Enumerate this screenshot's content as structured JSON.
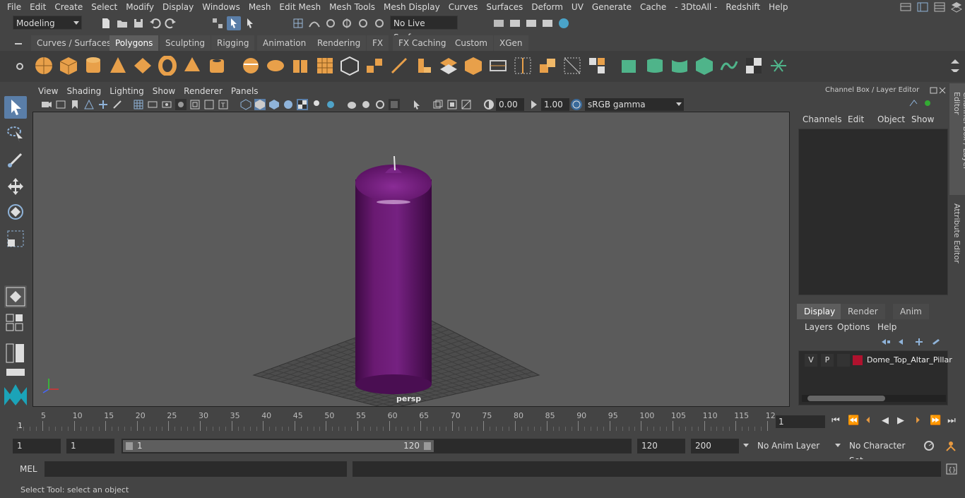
{
  "menubar": {
    "items": [
      "File",
      "Edit",
      "Create",
      "Select",
      "Modify",
      "Display",
      "Windows",
      "Mesh",
      "Edit Mesh",
      "Mesh Tools",
      "Mesh Display",
      "Curves",
      "Surfaces",
      "Deform",
      "UV",
      "Generate",
      "Cache",
      "- 3DtoAll -",
      "Redshift",
      "Help"
    ]
  },
  "statusline": {
    "mode": "Modeling",
    "live_surface": "No Live Surface"
  },
  "shelf": {
    "tabs": [
      "Curves / Surfaces",
      "Polygons",
      "Sculpting",
      "Rigging",
      "Animation",
      "Rendering",
      "FX",
      "FX Caching",
      "Custom",
      "XGen"
    ],
    "active_tab": "Polygons"
  },
  "viewport": {
    "menu": [
      "View",
      "Shading",
      "Lighting",
      "Show",
      "Renderer",
      "Panels"
    ],
    "exposure": "0.00",
    "gamma": "1.00",
    "color_space": "sRGB gamma",
    "camera_label": "persp",
    "object_color": "#6a1a72"
  },
  "channelbox": {
    "title": "Channel Box / Layer Editor",
    "menu": [
      "Channels",
      "Edit",
      "Object",
      "Show"
    ],
    "tabs": [
      "Display",
      "Render",
      "Anim"
    ],
    "active_tab": "Display",
    "layer_menu": [
      "Layers",
      "Options",
      "Help"
    ],
    "layer": {
      "visible": "V",
      "playback": "P",
      "name": "Dome_Top_Altar_Pillar",
      "color": "#b0122e"
    },
    "side_tabs": [
      "Channel Box / Layer Editor",
      "Attribute Editor"
    ]
  },
  "timeline": {
    "ticks": [
      "5",
      "10",
      "15",
      "20",
      "25",
      "30",
      "35",
      "40",
      "45",
      "50",
      "55",
      "60",
      "65",
      "70",
      "75",
      "80",
      "85",
      "90",
      "95",
      "100",
      "105",
      "110",
      "115",
      "12"
    ],
    "start_marker": "1",
    "current_frame": "1"
  },
  "range": {
    "start": "1",
    "playback_start": "1",
    "slider_start": "1",
    "slider_end": "120",
    "playback_end": "120",
    "end": "200",
    "anim_layer": "No Anim Layer",
    "character_set": "No Character Set"
  },
  "command": {
    "language": "MEL"
  },
  "helpline": {
    "text": "Select Tool: select an object"
  }
}
